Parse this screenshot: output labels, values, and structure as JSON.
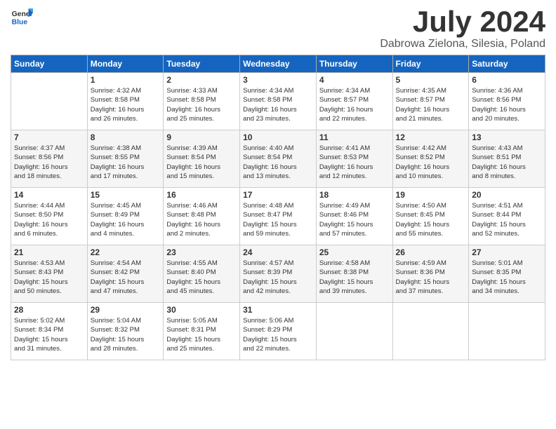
{
  "header": {
    "logo_general": "General",
    "logo_blue": "Blue",
    "month": "July 2024",
    "location": "Dabrowa Zielona, Silesia, Poland"
  },
  "weekdays": [
    "Sunday",
    "Monday",
    "Tuesday",
    "Wednesday",
    "Thursday",
    "Friday",
    "Saturday"
  ],
  "weeks": [
    [
      {
        "day": "",
        "info": ""
      },
      {
        "day": "1",
        "info": "Sunrise: 4:32 AM\nSunset: 8:58 PM\nDaylight: 16 hours\nand 26 minutes."
      },
      {
        "day": "2",
        "info": "Sunrise: 4:33 AM\nSunset: 8:58 PM\nDaylight: 16 hours\nand 25 minutes."
      },
      {
        "day": "3",
        "info": "Sunrise: 4:34 AM\nSunset: 8:58 PM\nDaylight: 16 hours\nand 23 minutes."
      },
      {
        "day": "4",
        "info": "Sunrise: 4:34 AM\nSunset: 8:57 PM\nDaylight: 16 hours\nand 22 minutes."
      },
      {
        "day": "5",
        "info": "Sunrise: 4:35 AM\nSunset: 8:57 PM\nDaylight: 16 hours\nand 21 minutes."
      },
      {
        "day": "6",
        "info": "Sunrise: 4:36 AM\nSunset: 8:56 PM\nDaylight: 16 hours\nand 20 minutes."
      }
    ],
    [
      {
        "day": "7",
        "info": "Sunrise: 4:37 AM\nSunset: 8:56 PM\nDaylight: 16 hours\nand 18 minutes."
      },
      {
        "day": "8",
        "info": "Sunrise: 4:38 AM\nSunset: 8:55 PM\nDaylight: 16 hours\nand 17 minutes."
      },
      {
        "day": "9",
        "info": "Sunrise: 4:39 AM\nSunset: 8:54 PM\nDaylight: 16 hours\nand 15 minutes."
      },
      {
        "day": "10",
        "info": "Sunrise: 4:40 AM\nSunset: 8:54 PM\nDaylight: 16 hours\nand 13 minutes."
      },
      {
        "day": "11",
        "info": "Sunrise: 4:41 AM\nSunset: 8:53 PM\nDaylight: 16 hours\nand 12 minutes."
      },
      {
        "day": "12",
        "info": "Sunrise: 4:42 AM\nSunset: 8:52 PM\nDaylight: 16 hours\nand 10 minutes."
      },
      {
        "day": "13",
        "info": "Sunrise: 4:43 AM\nSunset: 8:51 PM\nDaylight: 16 hours\nand 8 minutes."
      }
    ],
    [
      {
        "day": "14",
        "info": "Sunrise: 4:44 AM\nSunset: 8:50 PM\nDaylight: 16 hours\nand 6 minutes."
      },
      {
        "day": "15",
        "info": "Sunrise: 4:45 AM\nSunset: 8:49 PM\nDaylight: 16 hours\nand 4 minutes."
      },
      {
        "day": "16",
        "info": "Sunrise: 4:46 AM\nSunset: 8:48 PM\nDaylight: 16 hours\nand 2 minutes."
      },
      {
        "day": "17",
        "info": "Sunrise: 4:48 AM\nSunset: 8:47 PM\nDaylight: 15 hours\nand 59 minutes."
      },
      {
        "day": "18",
        "info": "Sunrise: 4:49 AM\nSunset: 8:46 PM\nDaylight: 15 hours\nand 57 minutes."
      },
      {
        "day": "19",
        "info": "Sunrise: 4:50 AM\nSunset: 8:45 PM\nDaylight: 15 hours\nand 55 minutes."
      },
      {
        "day": "20",
        "info": "Sunrise: 4:51 AM\nSunset: 8:44 PM\nDaylight: 15 hours\nand 52 minutes."
      }
    ],
    [
      {
        "day": "21",
        "info": "Sunrise: 4:53 AM\nSunset: 8:43 PM\nDaylight: 15 hours\nand 50 minutes."
      },
      {
        "day": "22",
        "info": "Sunrise: 4:54 AM\nSunset: 8:42 PM\nDaylight: 15 hours\nand 47 minutes."
      },
      {
        "day": "23",
        "info": "Sunrise: 4:55 AM\nSunset: 8:40 PM\nDaylight: 15 hours\nand 45 minutes."
      },
      {
        "day": "24",
        "info": "Sunrise: 4:57 AM\nSunset: 8:39 PM\nDaylight: 15 hours\nand 42 minutes."
      },
      {
        "day": "25",
        "info": "Sunrise: 4:58 AM\nSunset: 8:38 PM\nDaylight: 15 hours\nand 39 minutes."
      },
      {
        "day": "26",
        "info": "Sunrise: 4:59 AM\nSunset: 8:36 PM\nDaylight: 15 hours\nand 37 minutes."
      },
      {
        "day": "27",
        "info": "Sunrise: 5:01 AM\nSunset: 8:35 PM\nDaylight: 15 hours\nand 34 minutes."
      }
    ],
    [
      {
        "day": "28",
        "info": "Sunrise: 5:02 AM\nSunset: 8:34 PM\nDaylight: 15 hours\nand 31 minutes."
      },
      {
        "day": "29",
        "info": "Sunrise: 5:04 AM\nSunset: 8:32 PM\nDaylight: 15 hours\nand 28 minutes."
      },
      {
        "day": "30",
        "info": "Sunrise: 5:05 AM\nSunset: 8:31 PM\nDaylight: 15 hours\nand 25 minutes."
      },
      {
        "day": "31",
        "info": "Sunrise: 5:06 AM\nSunset: 8:29 PM\nDaylight: 15 hours\nand 22 minutes."
      },
      {
        "day": "",
        "info": ""
      },
      {
        "day": "",
        "info": ""
      },
      {
        "day": "",
        "info": ""
      }
    ]
  ]
}
